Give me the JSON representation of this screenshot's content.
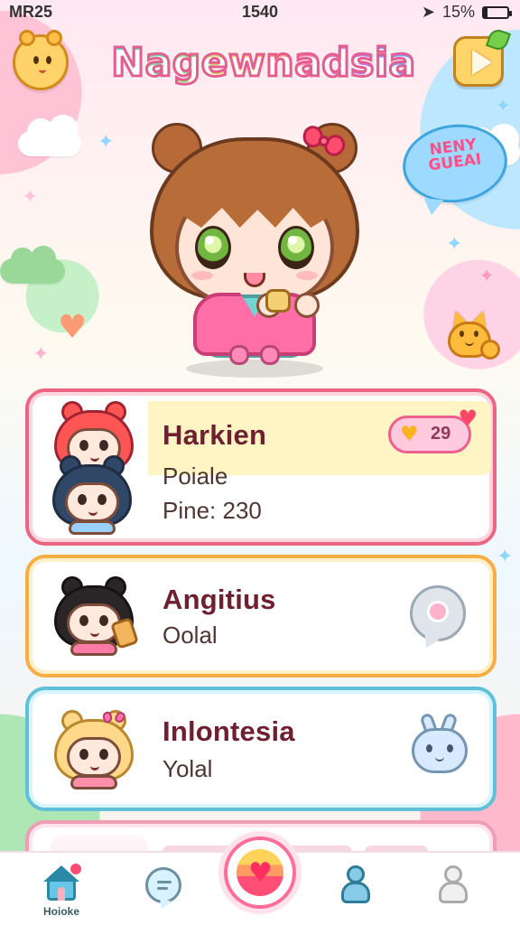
{
  "status_bar": {
    "left_text": "MR25",
    "time": "1540",
    "battery_text": "15%"
  },
  "header": {
    "title": "Nagewnadsia",
    "left_icon": "bear-icon",
    "right_icon": "play-icon"
  },
  "decorations": {
    "speech_text": "NENY GUEAI"
  },
  "cards": [
    {
      "title": "Harkien",
      "subtitle": "Poiale",
      "meta": "Pine: 230",
      "like_count": "29",
      "action_icon": "heart-like-icon"
    },
    {
      "title": "Angitius",
      "subtitle": "Oolal",
      "action_icon": "chat-bubble-icon"
    },
    {
      "title": "Inlontesia",
      "subtitle": "Yolal",
      "action_icon": "bunny-icon"
    }
  ],
  "bottom_nav": {
    "home_label": "Hoioke",
    "items": [
      "home-icon",
      "chat-icon",
      "heart-icon",
      "person-icon",
      "profile-icon"
    ]
  }
}
